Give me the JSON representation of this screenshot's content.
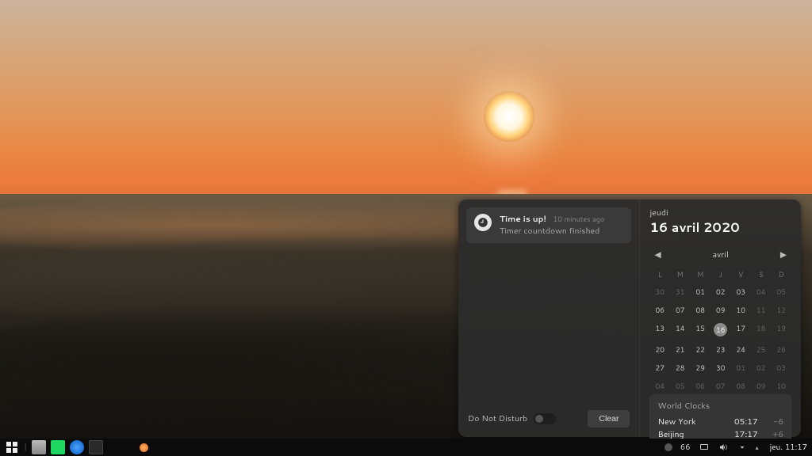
{
  "notification": {
    "title": "Time is up!",
    "time_ago": "10 minutes ago",
    "message": "Timer countdown finished"
  },
  "dnd": {
    "label": "Do Not Disturb"
  },
  "clear_label": "Clear",
  "date": {
    "dayname": "jeudi",
    "full": "16 avril 2020",
    "month": "avril"
  },
  "weekdays": [
    "L",
    "M",
    "M",
    "J",
    "V",
    "S",
    "D"
  ],
  "calendar": {
    "rows": [
      [
        {
          "d": "30",
          "dim": true
        },
        {
          "d": "31",
          "dim": true
        },
        {
          "d": "01"
        },
        {
          "d": "02"
        },
        {
          "d": "03"
        },
        {
          "d": "04",
          "dim": true
        },
        {
          "d": "05",
          "dim": true
        }
      ],
      [
        {
          "d": "06"
        },
        {
          "d": "07"
        },
        {
          "d": "08"
        },
        {
          "d": "09"
        },
        {
          "d": "10"
        },
        {
          "d": "11",
          "dim": true
        },
        {
          "d": "12",
          "dim": true
        }
      ],
      [
        {
          "d": "13"
        },
        {
          "d": "14"
        },
        {
          "d": "15"
        },
        {
          "d": "16",
          "today": true
        },
        {
          "d": "17"
        },
        {
          "d": "18",
          "dim": true
        },
        {
          "d": "19",
          "dim": true
        }
      ],
      [
        {
          "d": "20"
        },
        {
          "d": "21"
        },
        {
          "d": "22"
        },
        {
          "d": "23"
        },
        {
          "d": "24"
        },
        {
          "d": "25",
          "dim": true
        },
        {
          "d": "26",
          "dim": true
        }
      ],
      [
        {
          "d": "27"
        },
        {
          "d": "28"
        },
        {
          "d": "29"
        },
        {
          "d": "30"
        },
        {
          "d": "01",
          "dim": true
        },
        {
          "d": "02",
          "dim": true
        },
        {
          "d": "03",
          "dim": true
        }
      ],
      [
        {
          "d": "04",
          "dim": true
        },
        {
          "d": "05",
          "dim": true
        },
        {
          "d": "06",
          "dim": true
        },
        {
          "d": "07",
          "dim": true
        },
        {
          "d": "08",
          "dim": true
        },
        {
          "d": "09",
          "dim": true
        },
        {
          "d": "10",
          "dim": true
        }
      ]
    ]
  },
  "world_clocks": {
    "heading": "World Clocks",
    "rows": [
      {
        "city": "New York",
        "time": "05:17",
        "offset": "-6"
      },
      {
        "city": "Beijing",
        "time": "17:17",
        "offset": "+6"
      }
    ]
  },
  "taskbar": {
    "temp": "66",
    "clock": "jeu. 11:17"
  }
}
